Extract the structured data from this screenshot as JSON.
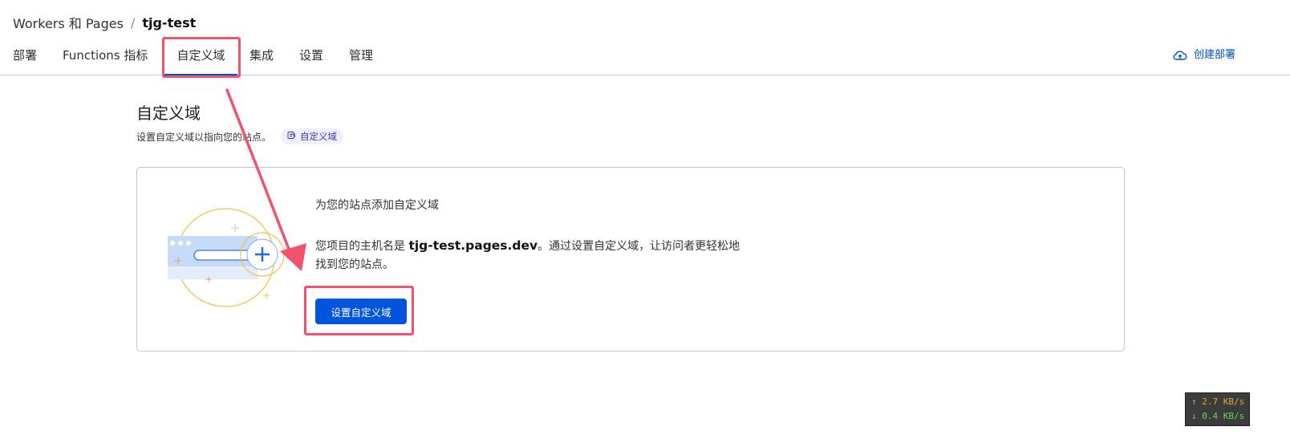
{
  "breadcrumb": {
    "parent": "Workers 和 Pages",
    "separator": "/",
    "current": "tjg-test"
  },
  "tabs": [
    {
      "label": "部署",
      "active": false
    },
    {
      "label": "Functions 指标",
      "active": false
    },
    {
      "label": "自定义域",
      "active": true
    },
    {
      "label": "集成",
      "active": false
    },
    {
      "label": "设置",
      "active": false
    },
    {
      "label": "管理",
      "active": false
    }
  ],
  "header_action": {
    "label": "创建部署",
    "icon": "cloud-upload-icon"
  },
  "section": {
    "title": "自定义域",
    "description": "设置自定义域以指向您的站点。",
    "doc_link": {
      "label": "自定义域",
      "icon": "doc-link-icon"
    }
  },
  "card": {
    "heading": "为您的站点添加自定义域",
    "body_prefix": "您项目的主机名是 ",
    "hostname": "tjg-test.pages.dev",
    "body_suffix": "。通过设置自定义域，让访问者更轻松地找到您的站点。",
    "button_label": "设置自定义域",
    "illustration": "browser-add-domain-illustration"
  },
  "network_widget": {
    "up": "↑ 2.7 KB/s",
    "down": "↓ 0.4 KB/s"
  },
  "colors": {
    "accent": "#0051c3",
    "primary_button": "#0055dc",
    "annotation": "#f1536e"
  }
}
